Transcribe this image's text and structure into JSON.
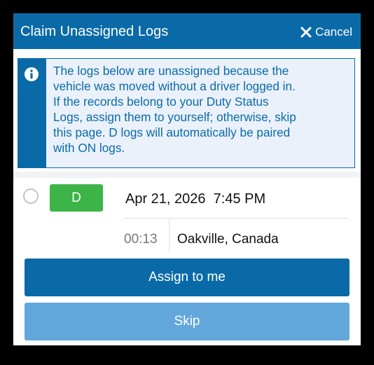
{
  "header": {
    "title": "Claim Unassigned Logs",
    "cancel_label": "Cancel",
    "cancel_icon": "close-icon"
  },
  "notice": {
    "icon": "info-icon",
    "lines": [
      "The logs below are unassigned because the",
      "vehicle was moved without a driver logged in.",
      "If the records belong to your Duty Status",
      "Logs, assign them to yourself; otherwise, skip",
      "this page. D logs will automatically be paired",
      "with ON logs."
    ]
  },
  "log": {
    "status": "D",
    "date": "Apr 21, 2026  7:45 PM",
    "duration": "00:13",
    "location": "Oakville, Canada",
    "selected": false
  },
  "actions": {
    "assign_label": "Assign to me",
    "skip_label": "Skip"
  },
  "colors": {
    "primary": "#0a6aa8",
    "secondary": "#61a7dc",
    "driving_badge": "#3db447",
    "notice_bg": "#eaf1fb"
  }
}
